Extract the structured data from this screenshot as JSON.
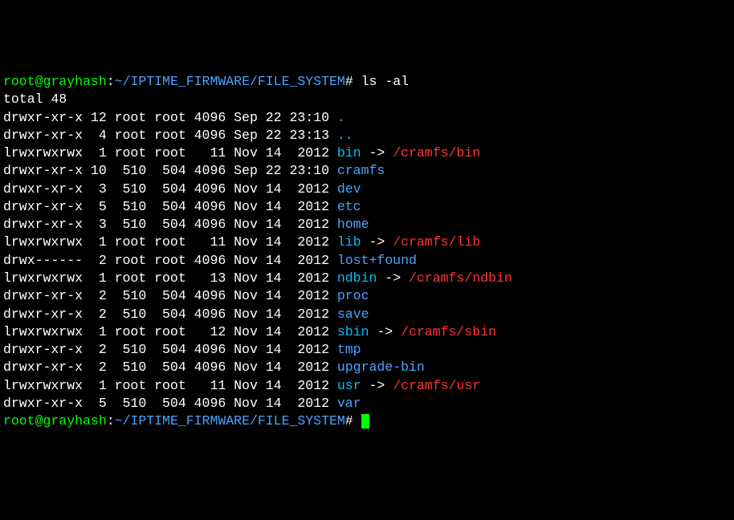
{
  "prompt1": {
    "user_host": "root@grayhash",
    "colon": ":",
    "path": "~/IPTIME_FIRMWARE/FILE_SYSTEM",
    "hash": "# ",
    "cmd": "ls -al"
  },
  "total_line": "total 48",
  "entries": [
    {
      "perm": "drwxr-xr-x",
      "nl": "12",
      "own": "root",
      "grp": "root",
      "size": "4096",
      "mon": "Sep",
      "day": "22",
      "tm": "23:10",
      "name": ".",
      "type": "dir"
    },
    {
      "perm": "drwxr-xr-x",
      "nl": " 4",
      "own": "root",
      "grp": "root",
      "size": "4096",
      "mon": "Sep",
      "day": "22",
      "tm": "23:13",
      "name": "..",
      "type": "dir"
    },
    {
      "perm": "lrwxrwxrwx",
      "nl": " 1",
      "own": "root",
      "grp": "root",
      "size": "  11",
      "mon": "Nov",
      "day": "14",
      "tm": " 2012",
      "name": "bin",
      "type": "link",
      "arrow": " -> ",
      "target": "/cramfs/bin"
    },
    {
      "perm": "drwxr-xr-x",
      "nl": "10",
      "own": " 510",
      "grp": " 504",
      "size": "4096",
      "mon": "Sep",
      "day": "22",
      "tm": "23:10",
      "name": "cramfs",
      "type": "dir"
    },
    {
      "perm": "drwxr-xr-x",
      "nl": " 3",
      "own": " 510",
      "grp": " 504",
      "size": "4096",
      "mon": "Nov",
      "day": "14",
      "tm": " 2012",
      "name": "dev",
      "type": "dir"
    },
    {
      "perm": "drwxr-xr-x",
      "nl": " 5",
      "own": " 510",
      "grp": " 504",
      "size": "4096",
      "mon": "Nov",
      "day": "14",
      "tm": " 2012",
      "name": "etc",
      "type": "dir"
    },
    {
      "perm": "drwxr-xr-x",
      "nl": " 3",
      "own": " 510",
      "grp": " 504",
      "size": "4096",
      "mon": "Nov",
      "day": "14",
      "tm": " 2012",
      "name": "home",
      "type": "dir"
    },
    {
      "perm": "lrwxrwxrwx",
      "nl": " 1",
      "own": "root",
      "grp": "root",
      "size": "  11",
      "mon": "Nov",
      "day": "14",
      "tm": " 2012",
      "name": "lib",
      "type": "link",
      "arrow": " -> ",
      "target": "/cramfs/lib"
    },
    {
      "perm": "drwx------",
      "nl": " 2",
      "own": "root",
      "grp": "root",
      "size": "4096",
      "mon": "Nov",
      "day": "14",
      "tm": " 2012",
      "name": "lost+found",
      "type": "dir"
    },
    {
      "perm": "lrwxrwxrwx",
      "nl": " 1",
      "own": "root",
      "grp": "root",
      "size": "  13",
      "mon": "Nov",
      "day": "14",
      "tm": " 2012",
      "name": "ndbin",
      "type": "link",
      "arrow": " -> ",
      "target": "/cramfs/ndbin"
    },
    {
      "perm": "drwxr-xr-x",
      "nl": " 2",
      "own": " 510",
      "grp": " 504",
      "size": "4096",
      "mon": "Nov",
      "day": "14",
      "tm": " 2012",
      "name": "proc",
      "type": "dir"
    },
    {
      "perm": "drwxr-xr-x",
      "nl": " 2",
      "own": " 510",
      "grp": " 504",
      "size": "4096",
      "mon": "Nov",
      "day": "14",
      "tm": " 2012",
      "name": "save",
      "type": "dir"
    },
    {
      "perm": "lrwxrwxrwx",
      "nl": " 1",
      "own": "root",
      "grp": "root",
      "size": "  12",
      "mon": "Nov",
      "day": "14",
      "tm": " 2012",
      "name": "sbin",
      "type": "link",
      "arrow": " -> ",
      "target": "/cramfs/sbin"
    },
    {
      "perm": "drwxr-xr-x",
      "nl": " 2",
      "own": " 510",
      "grp": " 504",
      "size": "4096",
      "mon": "Nov",
      "day": "14",
      "tm": " 2012",
      "name": "tmp",
      "type": "dir"
    },
    {
      "perm": "drwxr-xr-x",
      "nl": " 2",
      "own": " 510",
      "grp": " 504",
      "size": "4096",
      "mon": "Nov",
      "day": "14",
      "tm": " 2012",
      "name": "upgrade-bin",
      "type": "dir"
    },
    {
      "perm": "lrwxrwxrwx",
      "nl": " 1",
      "own": "root",
      "grp": "root",
      "size": "  11",
      "mon": "Nov",
      "day": "14",
      "tm": " 2012",
      "name": "usr",
      "type": "link",
      "arrow": " -> ",
      "target": "/cramfs/usr"
    },
    {
      "perm": "drwxr-xr-x",
      "nl": " 5",
      "own": " 510",
      "grp": " 504",
      "size": "4096",
      "mon": "Nov",
      "day": "14",
      "tm": " 2012",
      "name": "var",
      "type": "dir"
    }
  ],
  "prompt2": {
    "user_host": "root@grayhash",
    "colon": ":",
    "path": "~/IPTIME_FIRMWARE/FILE_SYSTEM",
    "hash": "# "
  }
}
